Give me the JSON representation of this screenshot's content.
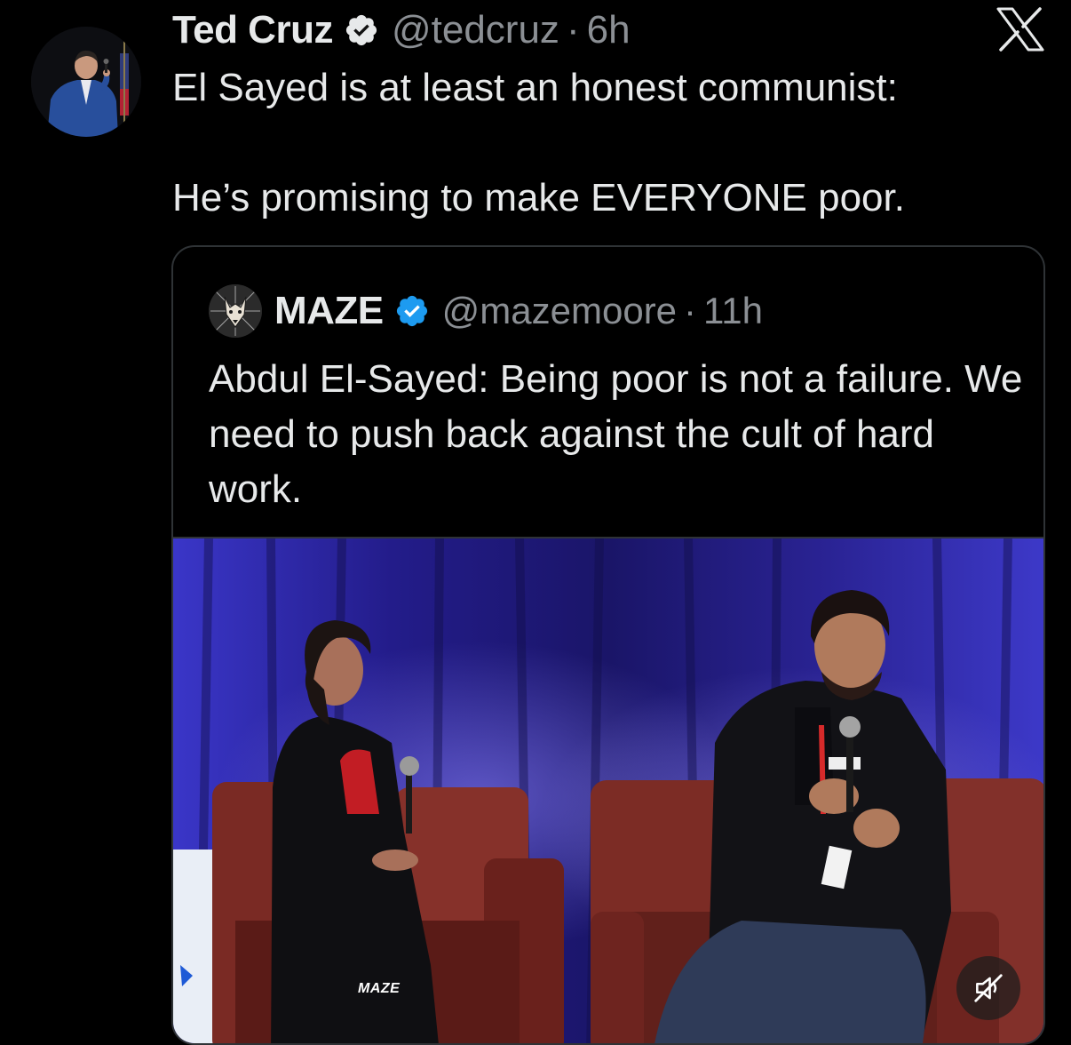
{
  "tweet": {
    "author_name": "Ted Cruz",
    "handle": "@tedcruz",
    "separator": "·",
    "time": "6h",
    "text_line1": "El Sayed is at least an honest communist:",
    "text_line2": "He’s promising to make EVERYONE poor."
  },
  "quoted": {
    "author_name": "MAZE",
    "handle": "@mazemoore",
    "separator": "·",
    "time": "11h",
    "text": "Abdul El-Sayed: Being poor is not a failure. We need to push back against the cult of hard work.",
    "media": {
      "watermark": "MAZE",
      "control": "mute-icon"
    }
  },
  "icons": {
    "verified": "verified-badge-icon",
    "logo": "x-logo-icon"
  },
  "colors": {
    "background": "#000000",
    "text_primary": "#e7e9ea",
    "text_secondary": "#8b8f94",
    "verified_blue": "#1d9bf0",
    "border": "#2f3336"
  }
}
